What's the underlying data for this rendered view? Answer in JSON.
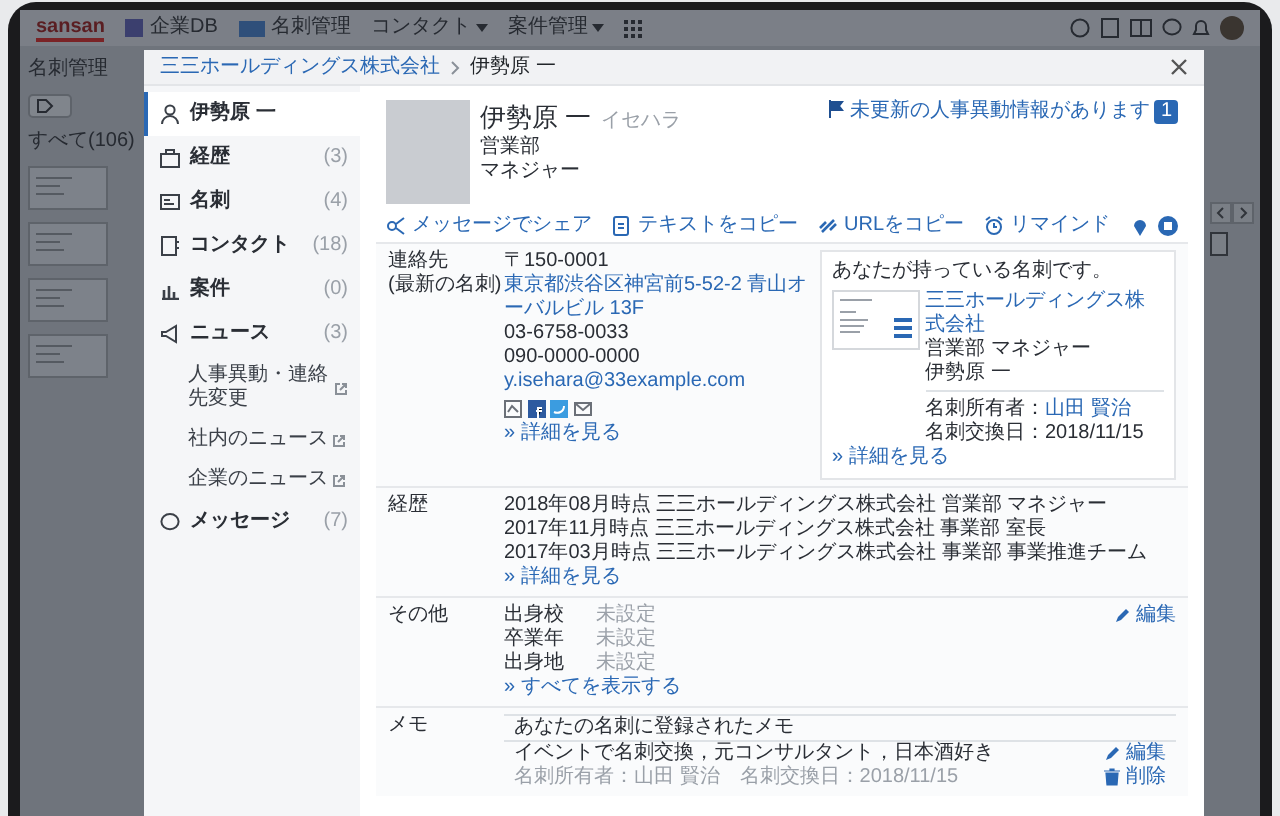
{
  "background_app": {
    "logo": "sansan",
    "nav": [
      {
        "label": "企業DB",
        "dropdown": false
      },
      {
        "label": "名刺管理",
        "dropdown": false
      },
      {
        "label": "コンタクト",
        "dropdown": true
      },
      {
        "label": "案件管理",
        "dropdown": true
      }
    ],
    "page_title": "名刺管理",
    "tab": "すべて(106)"
  },
  "modal": {
    "breadcrumb": [
      "三三ホールディングス株式会社",
      "伊勢原 一"
    ],
    "sidebar": [
      {
        "label": "伊勢原 一",
        "selected": true
      },
      {
        "label": "経歴",
        "count": "(3)",
        "selected": false
      },
      {
        "label": "名刺",
        "count": "(4)",
        "selected": false
      },
      {
        "label": "コンタクト",
        "count": "(18)",
        "selected": false
      },
      {
        "label": "案件",
        "count": "(0)",
        "selected": false
      },
      {
        "label": "ニュース",
        "count": "(3)",
        "selected": false,
        "children": [
          {
            "label": "人事異動・連絡先変更",
            "external": true
          },
          {
            "label": "社内のニュース",
            "external": true
          },
          {
            "label": "企業のニュース",
            "external": true
          }
        ]
      },
      {
        "label": "メッセージ",
        "count": "(7)",
        "selected": false
      }
    ],
    "profile": {
      "name": "伊勢原 一",
      "reading": "イセハラ",
      "department": "営業部",
      "title": "マネジャー",
      "notice": "未更新の人事異動情報があります",
      "notice_count": "1"
    },
    "actions": [
      "メッセージでシェア",
      "テキストをコピー",
      "URLをコピー",
      "リマインド"
    ],
    "contact": {
      "label": "連絡先",
      "sublabel": "(最新の名刺)",
      "postal": "〒150-0001",
      "address": "東京都渋谷区神宮前5-52-2 青山オーバルビル 13F",
      "phone": "03-6758-0033",
      "mobile": "090-0000-0000",
      "email": "y.isehara@33example.com",
      "more": "» 詳細を見る",
      "card": {
        "heading": "あなたが持っている名刺です。",
        "company": "三三ホールディングス株式会社",
        "position": "営業部 マネジャー",
        "name": "伊勢原 一",
        "owner_label": "名刺所有者：",
        "owner": "山田 賢治",
        "exchange_date": "名刺交換日：2018/11/15",
        "more": "» 詳細を見る"
      }
    },
    "career": {
      "label": "経歴",
      "entries": [
        "2018年08月時点 三三ホールディングス株式会社 営業部 マネジャー",
        "2017年11月時点 三三ホールディングス株式会社 事業部 室長",
        "2017年03月時点 三三ホールディングス株式会社 事業部 事業推進チーム"
      ],
      "more": "» 詳細を見る"
    },
    "other": {
      "label": "その他",
      "fields": [
        {
          "name": "出身校",
          "value": "未設定"
        },
        {
          "name": "卒業年",
          "value": "未設定"
        },
        {
          "name": "出身地",
          "value": "未設定"
        }
      ],
      "more": "» すべてを表示する",
      "edit": "編集"
    },
    "memo": {
      "label": "メモ",
      "heading": "あなたの名刺に登録されたメモ",
      "text": "イベントで名刺交換，元コンサルタント，日本酒好き",
      "meta": "名刺所有者：山田 賢治　名刺交換日：2018/11/15",
      "edit": "編集",
      "delete": "削除"
    }
  }
}
